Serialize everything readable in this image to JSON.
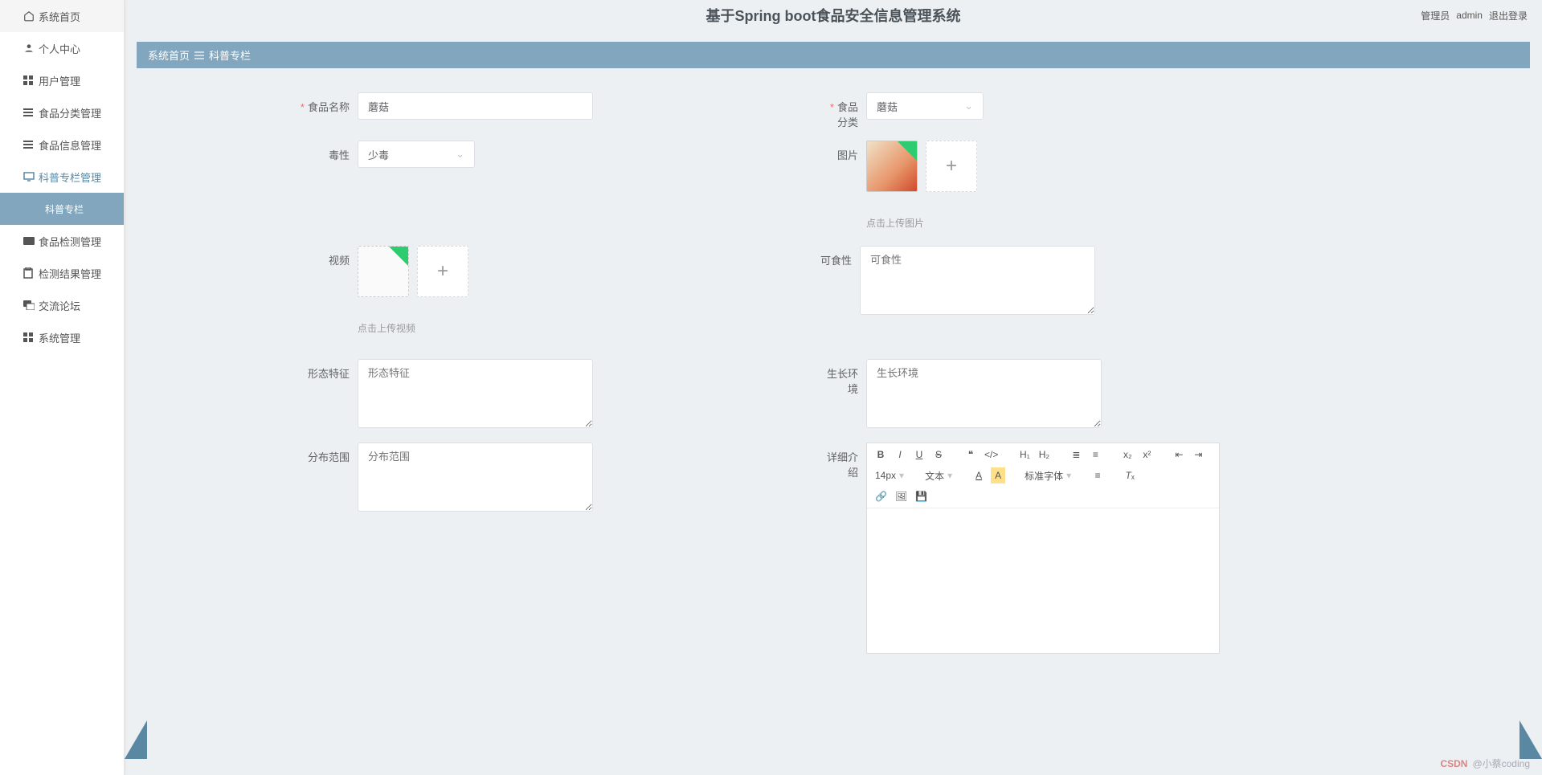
{
  "header": {
    "title": "基于Spring boot食品安全信息管理系统",
    "role": "管理员",
    "user": "admin",
    "logout": "退出登录"
  },
  "breadcrumb": {
    "home": "系统首页",
    "current": "科普专栏"
  },
  "sidebar": {
    "items": [
      {
        "label": "系统首页",
        "icon": "home"
      },
      {
        "label": "个人中心",
        "icon": "person"
      },
      {
        "label": "用户管理",
        "icon": "grid"
      },
      {
        "label": "食品分类管理",
        "icon": "list"
      },
      {
        "label": "食品信息管理",
        "icon": "list"
      },
      {
        "label": "科普专栏管理",
        "icon": "monitor"
      },
      {
        "label": "科普专栏",
        "icon": "",
        "active": true
      },
      {
        "label": "食品检测管理",
        "icon": "card"
      },
      {
        "label": "检测结果管理",
        "icon": "clipboard"
      },
      {
        "label": "交流论坛",
        "icon": "chat"
      },
      {
        "label": "系统管理",
        "icon": "grid"
      }
    ]
  },
  "form": {
    "foodName": {
      "label": "食品名称",
      "value": "蘑菇"
    },
    "foodCategory": {
      "label": "食品分类",
      "value": "蘑菇"
    },
    "toxicity": {
      "label": "毒性",
      "value": "少毒"
    },
    "image": {
      "label": "图片",
      "hint": "点击上传图片"
    },
    "video": {
      "label": "视频",
      "hint": "点击上传视频"
    },
    "edibility": {
      "label": "可食性",
      "placeholder": "可食性"
    },
    "morphology": {
      "label": "形态特征",
      "placeholder": "形态特征"
    },
    "environment": {
      "label": "生长环境",
      "placeholder": "生长环境"
    },
    "distribution": {
      "label": "分布范围",
      "placeholder": "分布范围"
    },
    "detail": {
      "label": "详细介绍"
    }
  },
  "editor": {
    "fontSize": "14px",
    "textLabel": "文本",
    "fontFamily": "标准字体"
  },
  "watermark": {
    "brand": "CSDN",
    "user": "@小蔡coding"
  }
}
